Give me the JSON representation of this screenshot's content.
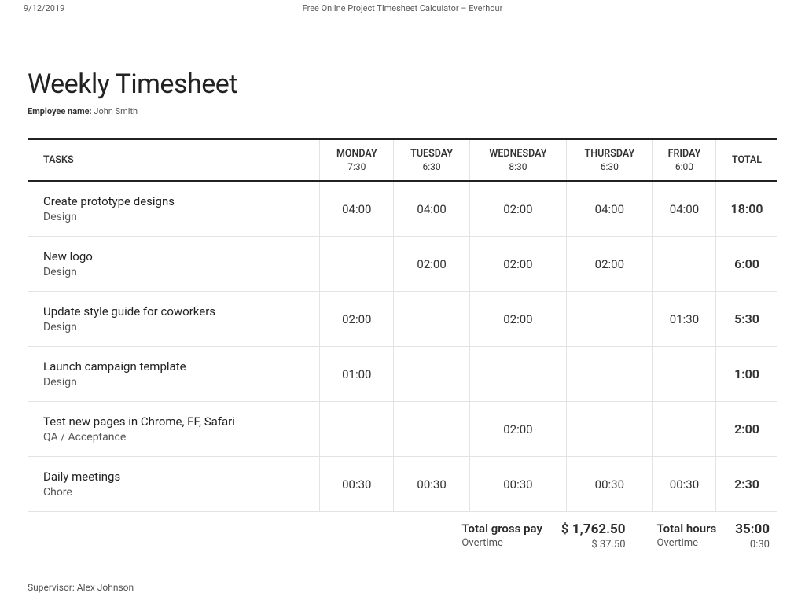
{
  "printHeader": {
    "date": "9/12/2019",
    "title": "Free Online Project Timesheet Calculator – Everhour"
  },
  "page": {
    "title": "Weekly Timesheet",
    "employeeLabel": "Employee name:",
    "employeeName": "John Smith"
  },
  "columns": {
    "tasks": "TASKS",
    "days": [
      {
        "label": "MONDAY",
        "sub": "7:30"
      },
      {
        "label": "TUESDAY",
        "sub": "6:30"
      },
      {
        "label": "WEDNESDAY",
        "sub": "8:30"
      },
      {
        "label": "THURSDAY",
        "sub": "6:30"
      },
      {
        "label": "FRIDAY",
        "sub": "6:00"
      }
    ],
    "total": "TOTAL"
  },
  "rows": [
    {
      "name": "Create prototype designs",
      "category": "Design",
      "cells": [
        "04:00",
        "04:00",
        "02:00",
        "04:00",
        "04:00"
      ],
      "total": "18:00"
    },
    {
      "name": "New logo",
      "category": "Design",
      "cells": [
        "",
        "02:00",
        "02:00",
        "02:00",
        ""
      ],
      "total": "6:00"
    },
    {
      "name": "Update style guide for coworkers",
      "category": "Design",
      "cells": [
        "02:00",
        "",
        "02:00",
        "",
        "01:30"
      ],
      "total": "5:30"
    },
    {
      "name": "Launch campaign template",
      "category": "Design",
      "cells": [
        "01:00",
        "",
        "",
        "",
        ""
      ],
      "total": "1:00"
    },
    {
      "name": "Test new pages in Chrome, FF, Safari",
      "category": "QA / Acceptance",
      "cells": [
        "",
        "",
        "02:00",
        "",
        ""
      ],
      "total": "2:00"
    },
    {
      "name": "Daily meetings",
      "category": "Chore",
      "cells": [
        "00:30",
        "00:30",
        "00:30",
        "00:30",
        "00:30"
      ],
      "total": "2:30"
    }
  ],
  "summary": {
    "grossLabel": "Total gross pay",
    "grossValue": "$ 1,762.50",
    "grossOvertimeLabel": "Overtime",
    "grossOvertimeValue": "$ 37.50",
    "hoursLabel": "Total hours",
    "hoursValue": "35:00",
    "hoursOvertimeLabel": "Overtime",
    "hoursOvertimeValue": "0:30"
  },
  "supervisor": {
    "label": "Supervisor:",
    "name": "Alex Johnson",
    "line": "____________________"
  }
}
